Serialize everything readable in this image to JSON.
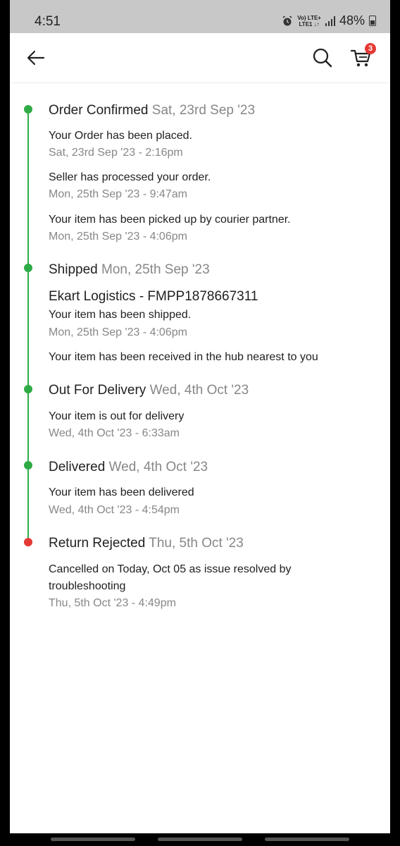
{
  "status_bar": {
    "time": "4:51",
    "network": "VoLTE LTE+",
    "battery": "48%"
  },
  "app_bar": {
    "icons": [
      "back-arrow-icon",
      "search-icon",
      "cart-icon"
    ],
    "cart_count": "3"
  },
  "colors": {
    "success": "#2eab45",
    "error": "#e53935",
    "muted_text": "#878787"
  },
  "timeline": [
    {
      "title": "Order Confirmed",
      "date": "Sat, 23rd Sep '23",
      "status": "success",
      "events": [
        {
          "text": "Your Order has been placed.",
          "time": "Sat, 23rd Sep '23 - 2:16pm"
        },
        {
          "text": "Seller has processed your order.",
          "time": "Mon, 25th Sep '23 - 9:47am"
        },
        {
          "text": "Your item has been picked up by courier partner.",
          "time": "Mon, 25th Sep '23 - 4:06pm"
        }
      ]
    },
    {
      "title": "Shipped",
      "date": "Mon, 25th Sep '23",
      "status": "success",
      "courier": "Ekart Logistics - FMPP1878667311",
      "events": [
        {
          "text": "Your item has been shipped.",
          "time": "Mon, 25th Sep '23 - 4:06pm"
        },
        {
          "text": "Your item has been received in the hub nearest to you"
        }
      ]
    },
    {
      "title": "Out For Delivery",
      "date": "Wed, 4th Oct '23",
      "status": "success",
      "events": [
        {
          "text": "Your item is out for delivery",
          "time": "Wed, 4th Oct '23 - 6:33am"
        }
      ]
    },
    {
      "title": "Delivered",
      "date": "Wed, 4th Oct '23",
      "status": "success",
      "events": [
        {
          "text": "Your item has been delivered",
          "time": "Wed, 4th Oct '23 - 4:54pm"
        }
      ]
    },
    {
      "title": "Return Rejected",
      "date": "Thu, 5th Oct '23",
      "status": "error",
      "events": [
        {
          "text_line1": "Cancelled on Today, Oct 05 as issue resolved by",
          "text_line2": "troubleshooting",
          "time": "Thu, 5th Oct '23 - 4:49pm"
        }
      ]
    }
  ]
}
